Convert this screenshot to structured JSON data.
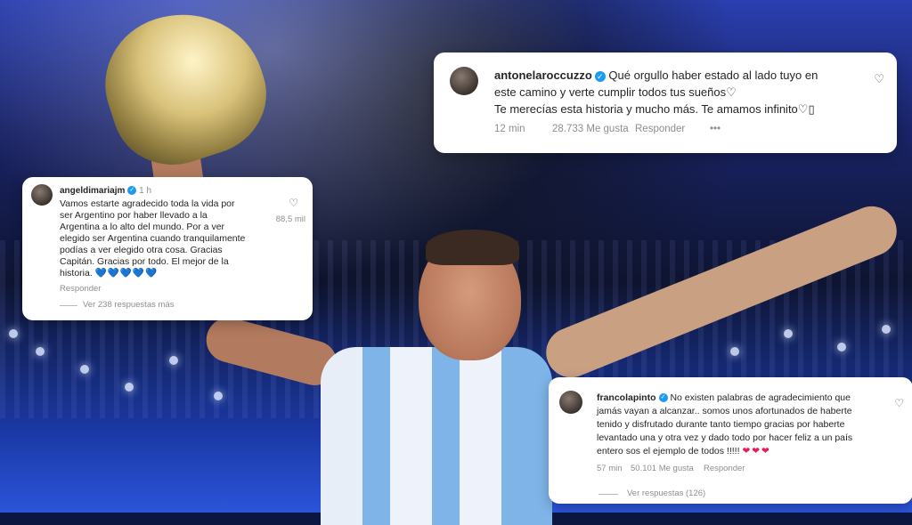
{
  "comments": {
    "antonela": {
      "username": "antonelaroccuzzo",
      "text_line1": "Qué orgullo haber estado al lado tuyo en",
      "text_line2": "este camino y verte cumplir todos tus sueños♡",
      "text_line3": "Te merecías esta historia y mucho más. Te amamos infinito♡▯",
      "time": "12 min",
      "likes": "28.733 Me gusta",
      "reply": "Responder",
      "more": "•••"
    },
    "angel": {
      "username": "angeldimariajm",
      "time": "1 h",
      "lines": [
        "Vamos estarte agradecido toda la vida por",
        "ser Argentino por haber llevado a la",
        "Argentina a lo alto del mundo. Por a ver",
        "elegido ser Argentina cuando tranquilamente",
        "podías a ver elegido otra cosa. Gracias",
        "Capitán. Gracias por todo. El mejor de la",
        "historia."
      ],
      "hearts": "💙💙💙💙💙",
      "like_count": "88,5 mil",
      "reply": "Responder",
      "view_replies": "Ver 238 respuestas más"
    },
    "franco": {
      "username": "francolapinto",
      "lines": [
        "No existen palabras de agradecimiento que",
        "jamás vayan a alcanzar.. somos unos afortunados de haberte",
        "tenido y disfrutado durante tanto tiempo gracias por haberte",
        "levantado una y otra vez y dado todo por hacer feliz a un país",
        "entero sos el ejemplo de todos !!!!!"
      ],
      "hearts": "❤❤❤",
      "time": "57 min",
      "likes": "50.101 Me gusta",
      "reply": "Responder",
      "view_replies": "Ver respuestas (126)"
    }
  },
  "colors": {
    "verified": "#1d9bf0",
    "blue_hearts": "#1a8cff",
    "pink_hearts": "#ec1a5a"
  }
}
